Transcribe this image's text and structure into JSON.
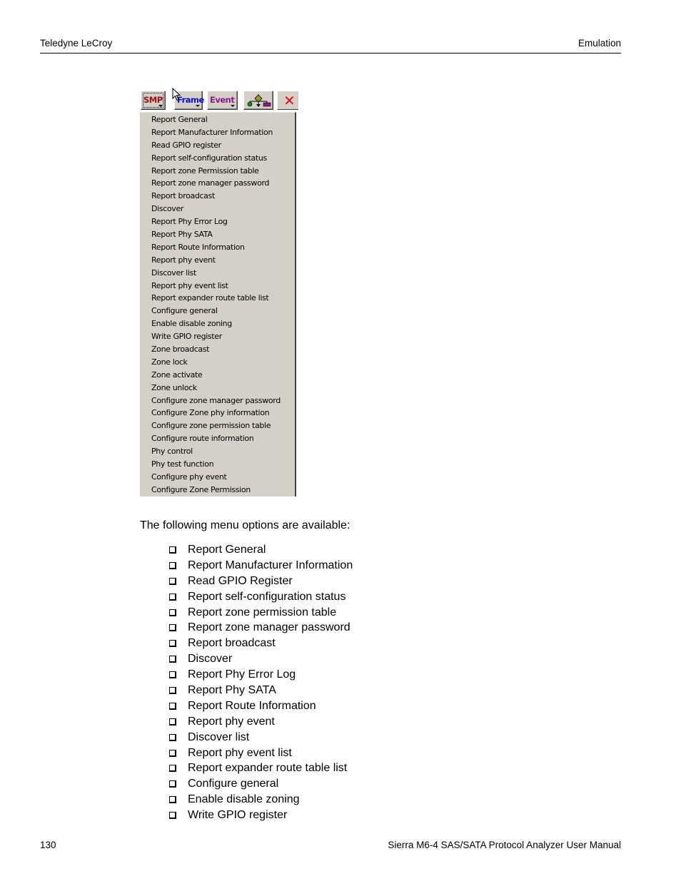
{
  "header": {
    "left": "Teledyne LeCroy",
    "right": "Emulation"
  },
  "footer": {
    "page_number": "130",
    "manual_title": "Sierra M6-4 SAS/SATA Protocol Analyzer User Manual"
  },
  "figure": {
    "toolbar": {
      "buttons": [
        {
          "label": "SMP",
          "icon": "dropdown-arrow",
          "color": "#a01010"
        },
        {
          "label": "Frame",
          "icon": "dropdown-arrow",
          "color": "#1010e0"
        },
        {
          "label": "Event",
          "icon": "dropdown-arrow",
          "color": "#8a1a8a"
        },
        {
          "label": "",
          "icon": "flow-diagram-icon"
        },
        {
          "label": "",
          "icon": "close-icon",
          "color": "#e01010"
        }
      ]
    },
    "menu_items": [
      "Report General",
      "Report Manufacturer Information",
      "Read GPIO register",
      "Report self-configuration status",
      "Report zone Permission table",
      "Report zone manager password",
      "Report broadcast",
      "Discover",
      "Report Phy Error Log",
      "Report Phy SATA",
      "Report Route Information",
      "Report phy event",
      "Discover list",
      "Report phy event list",
      "Report expander route table list",
      "Configure general",
      "Enable disable zoning",
      "Write GPIO register",
      "Zone broadcast",
      "Zone lock",
      "Zone activate",
      "Zone unlock",
      "Configure zone manager password",
      "Configure Zone phy information",
      "Configure zone permission table",
      "Configure route information",
      "Phy control",
      "Phy test function",
      "Configure phy event",
      "Configure Zone Permission"
    ]
  },
  "body": {
    "intro": "The following menu options are available:",
    "bullets": [
      "Report General",
      "Report Manufacturer Information",
      "Read GPIO Register",
      "Report self-configuration status",
      "Report zone permission table",
      "Report zone manager password",
      "Report broadcast",
      "Discover",
      "Report Phy Error Log",
      "Report Phy SATA",
      "Report Route Information",
      "Report phy event",
      "Discover list",
      "Report phy event list",
      "Report expander route table list",
      "Configure general",
      "Enable disable zoning",
      "Write GPIO register"
    ]
  }
}
